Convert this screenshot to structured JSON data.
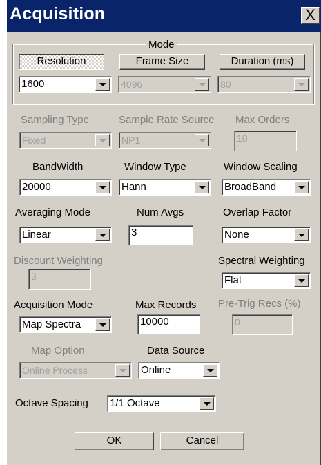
{
  "window": {
    "title": "Acquisition",
    "close_glyph": "X"
  },
  "mode": {
    "group_label": "Mode",
    "resolution_label": "Resolution",
    "frame_size_label": "Frame Size",
    "duration_label": "Duration (ms)",
    "resolution_value": "1600",
    "frame_size_value": "4096",
    "duration_value": "80"
  },
  "sampling": {
    "sampling_type_label": "Sampling Type",
    "sampling_type_value": "Fixed",
    "sample_rate_source_label": "Sample Rate Source",
    "sample_rate_source_value": "NP1",
    "max_orders_label": "Max Orders",
    "max_orders_value": "10"
  },
  "bandwidth": {
    "bandwidth_label": "BandWidth",
    "bandwidth_value": "20000",
    "window_type_label": "Window Type",
    "window_type_value": "Hann",
    "window_scaling_label": "Window Scaling",
    "window_scaling_value": "BroadBand"
  },
  "averaging": {
    "averaging_mode_label": "Averaging Mode",
    "averaging_mode_value": "Linear",
    "num_avgs_label": "Num Avgs",
    "num_avgs_value": "3",
    "overlap_factor_label": "Overlap Factor",
    "overlap_factor_value": "None"
  },
  "weighting": {
    "discount_label": "Discount Weighting",
    "discount_value": "3",
    "spectral_label": "Spectral Weighting",
    "spectral_value": "Flat"
  },
  "acquisition": {
    "mode_label": "Acquisition Mode",
    "mode_value": "Map Spectra",
    "max_records_label": "Max Records",
    "max_records_value": "10000",
    "pretrig_label": "Pre-Trig Recs (%)",
    "pretrig_value": "0"
  },
  "map": {
    "map_option_label": "Map Option",
    "map_option_value": "Online Process",
    "data_source_label": "Data Source",
    "data_source_value": "Online"
  },
  "octave": {
    "label": "Octave Spacing",
    "value": "1/1 Octave"
  },
  "buttons": {
    "ok": "OK",
    "cancel": "Cancel"
  },
  "colors": {
    "titlebar": "#0a246a",
    "face": "#d4d0c8",
    "disabled_text": "#a0a0a0"
  }
}
